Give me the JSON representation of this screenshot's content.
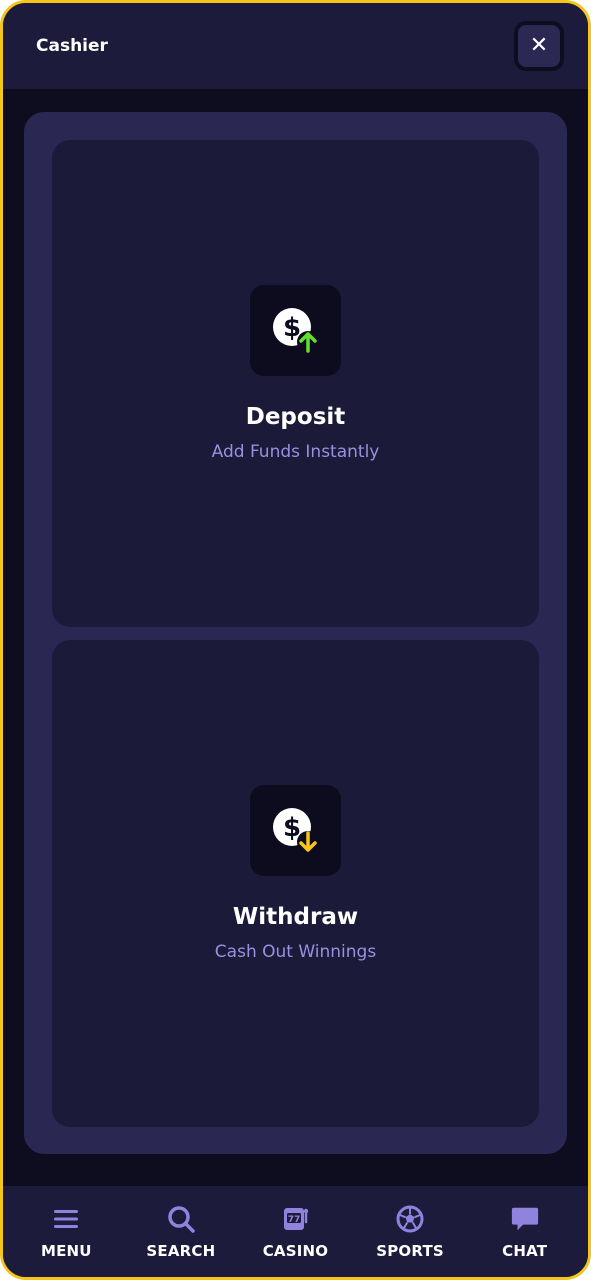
{
  "header": {
    "title": "Cashier",
    "close_label": "✕"
  },
  "cards": [
    {
      "title": "Deposit",
      "subtitle": "Add Funds Instantly",
      "icon": "dollar-arrow-up-icon",
      "accent": "#63e02b"
    },
    {
      "title": "Withdraw",
      "subtitle": "Cash Out Winnings",
      "icon": "dollar-arrow-down-icon",
      "accent": "#f5c518"
    }
  ],
  "nav": {
    "items": [
      {
        "label": "MENU",
        "icon": "hamburger-icon"
      },
      {
        "label": "SEARCH",
        "icon": "search-icon"
      },
      {
        "label": "CASINO",
        "icon": "slot-machine-icon"
      },
      {
        "label": "SPORTS",
        "icon": "soccer-ball-icon"
      },
      {
        "label": "CHAT",
        "icon": "chat-bubble-icon"
      }
    ]
  },
  "colors": {
    "background": "#0d0d1f",
    "panel": "#2a2853",
    "card": "#1b1a39",
    "header": "#1d1b3b",
    "subtitle": "#9b8fe0",
    "nav_icon": "#8f83de",
    "frame_border": "#f5c518"
  }
}
